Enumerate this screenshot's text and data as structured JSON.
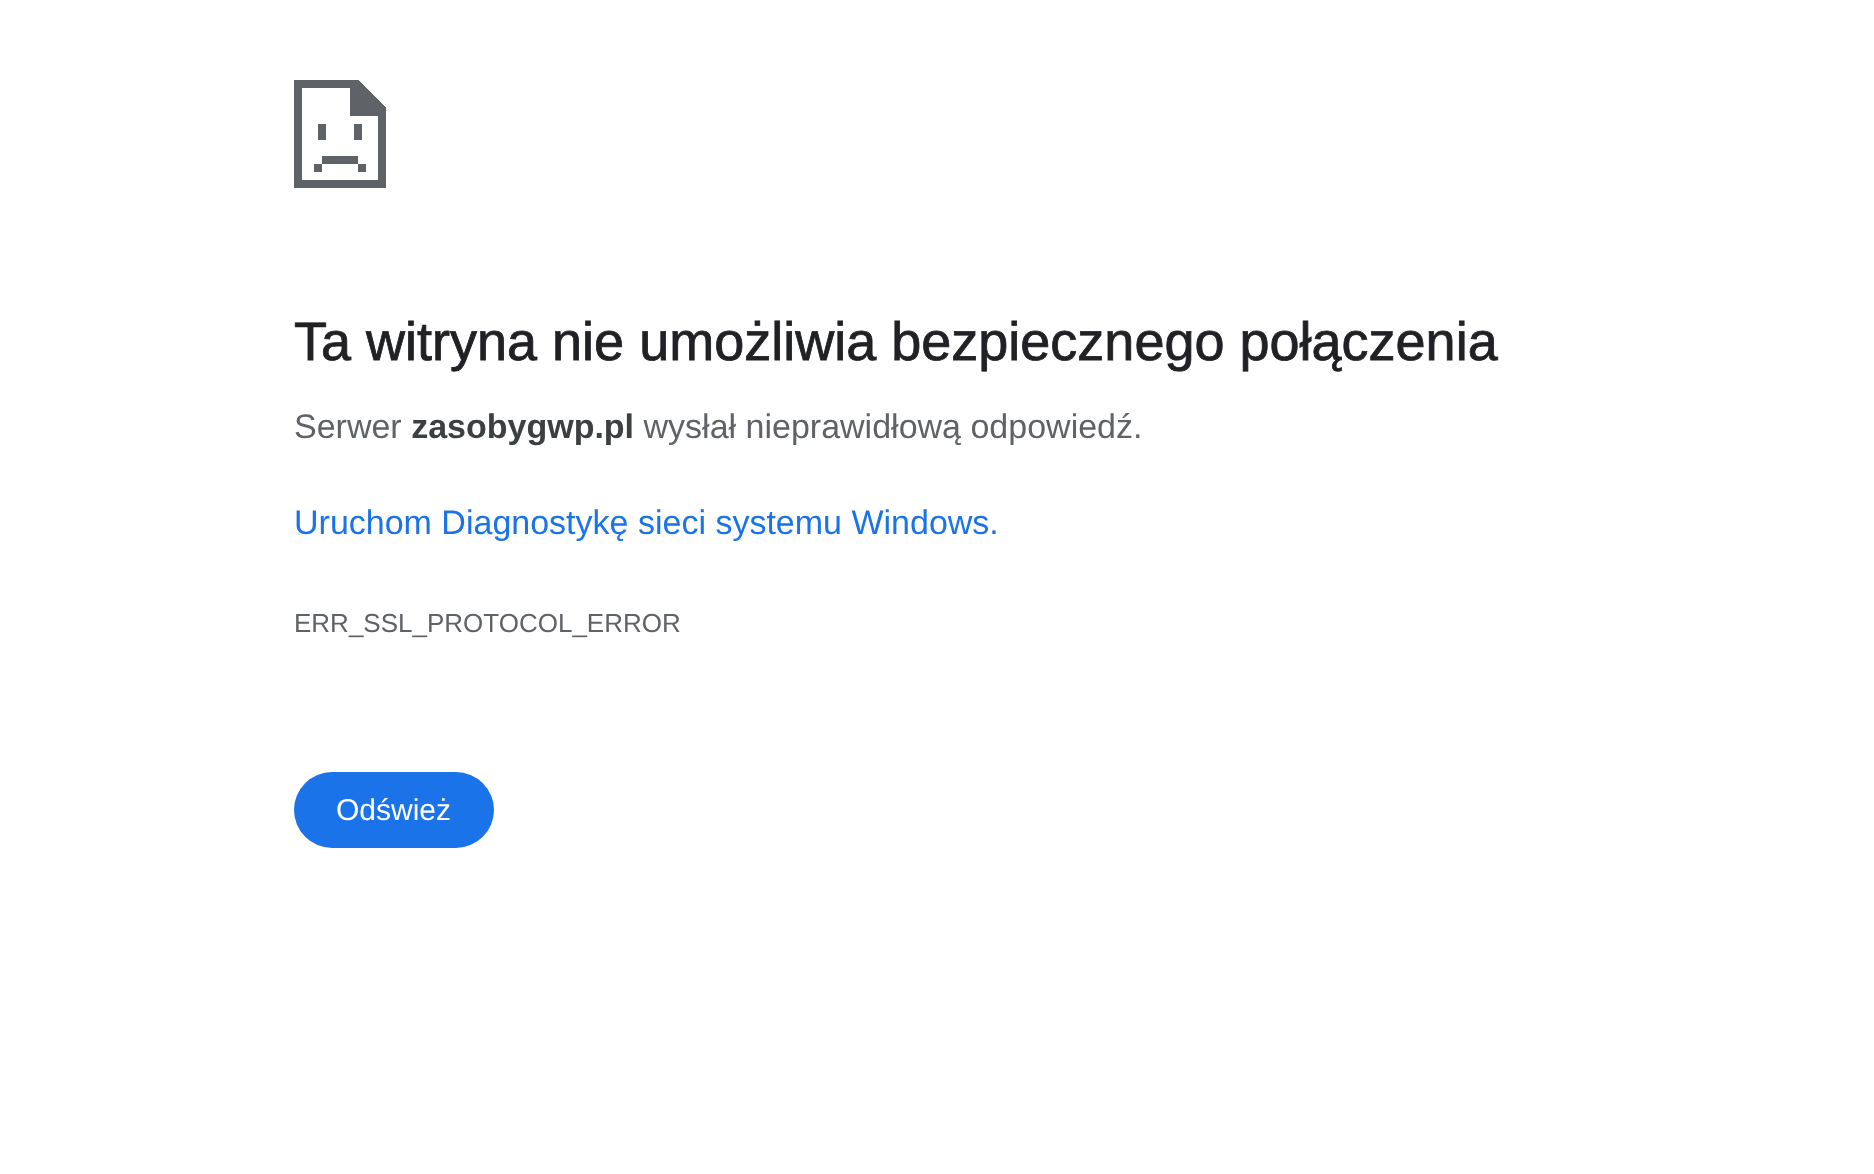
{
  "heading": "Ta witryna nie umożliwia bezpiecznego połączenia",
  "message": "Serwer **zasobygwp.pl** wysłał nieprawidłową odpowiedź.",
  "link": "Uruchom Diagnostykę sieci systemu Windows.",
  "error_code": "ERR_SSL_PROTOCOL_ERROR",
  "button": "Odśwież"
}
